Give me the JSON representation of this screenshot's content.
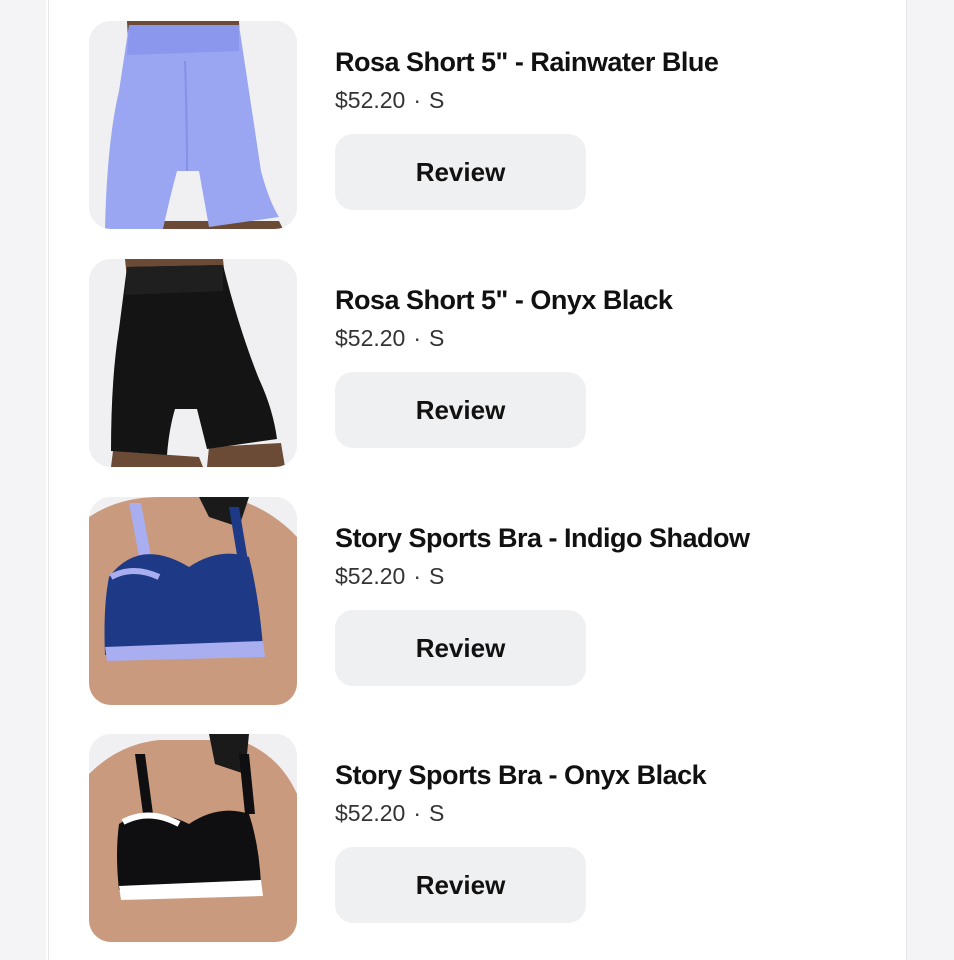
{
  "items": [
    {
      "title": "Rosa Short 5\" - Rainwater Blue",
      "price": "$52.20",
      "separator": "·",
      "size": "S",
      "review_label": "Review",
      "image_icon": "product-photo-shorts-blue",
      "garment_color": "#9aa6f2"
    },
    {
      "title": "Rosa Short 5\" - Onyx Black",
      "price": "$52.20",
      "separator": "·",
      "size": "S",
      "review_label": "Review",
      "image_icon": "product-photo-shorts-black",
      "garment_color": "#111111"
    },
    {
      "title": "Story Sports Bra - Indigo Shadow",
      "price": "$52.20",
      "separator": "·",
      "size": "S",
      "review_label": "Review",
      "image_icon": "product-photo-bra-indigo",
      "garment_color": "#1e3a86",
      "trim_color": "#a9aef0"
    },
    {
      "title": "Story Sports Bra - Onyx Black",
      "price": "$52.20",
      "separator": "·",
      "size": "S",
      "review_label": "Review",
      "image_icon": "product-photo-bra-black",
      "garment_color": "#0f0f12",
      "trim_color": "#ffffff"
    }
  ]
}
